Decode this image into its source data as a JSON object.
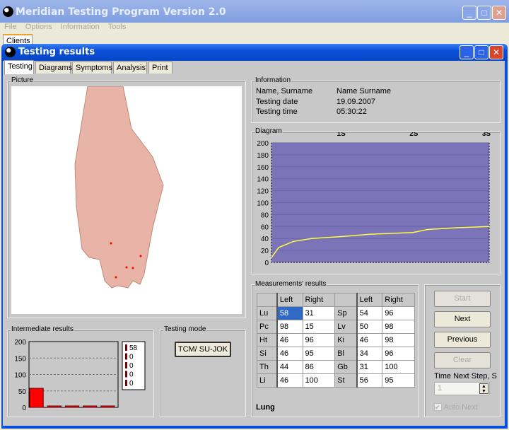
{
  "app": {
    "title": "Meridian Testing Program Version 2.0",
    "menu": [
      "File",
      "Options",
      "Information",
      "Tools"
    ],
    "client_tab": "Clients"
  },
  "window": {
    "title": "Testing results",
    "tabs": [
      "Testing",
      "Diagrams",
      "Symptoms",
      "Analysis",
      "Print"
    ],
    "active_tab": "Testing"
  },
  "picture": {
    "label": "Picture"
  },
  "information": {
    "label": "Information",
    "rows": [
      {
        "k": "Name, Surname",
        "v": "Name Surname"
      },
      {
        "k": "Testing date",
        "v": "19.09.2007"
      },
      {
        "k": "Testing time",
        "v": "05:30:22"
      }
    ]
  },
  "chart_data": [
    {
      "type": "line",
      "title": "Diagram",
      "x_ticks": [
        "1S",
        "2S",
        "3S"
      ],
      "y_ticks": [
        0,
        20,
        40,
        60,
        80,
        100,
        120,
        140,
        160,
        180,
        200
      ],
      "ylim": [
        0,
        200
      ],
      "xlim": [
        0,
        3
      ],
      "grid": true,
      "background": "#7b74b8",
      "line_color": "#ffff40",
      "x": [
        0,
        0.1,
        0.3,
        0.55,
        0.95,
        1.35,
        1.95,
        2.15,
        2.55,
        3.0
      ],
      "y": [
        8,
        25,
        35,
        40,
        43,
        47,
        50,
        55,
        58,
        60
      ]
    },
    {
      "type": "bar",
      "title": "Intermediate results",
      "ylim": [
        0,
        200
      ],
      "y_ticks": [
        0,
        50,
        100,
        150,
        200
      ],
      "grid": true,
      "values": [
        58,
        0,
        0,
        0,
        0
      ],
      "legend": [
        "58",
        "0",
        "0",
        "0",
        "0"
      ],
      "bar_color": "#ff0000"
    }
  ],
  "testing_mode": {
    "label": "Testing mode",
    "button": "TCM/ SU-JOK"
  },
  "measurements": {
    "label": "Measurements' results",
    "headers": [
      "",
      "Left",
      "Right",
      "",
      "Left",
      "Right"
    ],
    "rows": [
      [
        "Lu",
        "58",
        "31",
        "Sp",
        "54",
        "96"
      ],
      [
        "Pc",
        "98",
        "15",
        "Lv",
        "50",
        "98"
      ],
      [
        "Ht",
        "46",
        "96",
        "Ki",
        "46",
        "98"
      ],
      [
        "Si",
        "46",
        "95",
        "Bl",
        "34",
        "96"
      ],
      [
        "Th",
        "44",
        "86",
        "Gb",
        "31",
        "100"
      ],
      [
        "Li",
        "46",
        "100",
        "St",
        "56",
        "95"
      ]
    ],
    "selected": "Lung"
  },
  "controls": {
    "start": "Start",
    "next": "Next",
    "previous": "Previous",
    "clear": "Clear",
    "time_label": "Time Next Step, S",
    "time_value": "1",
    "auto_next": "Auto Next",
    "auto_next_checked": true
  }
}
